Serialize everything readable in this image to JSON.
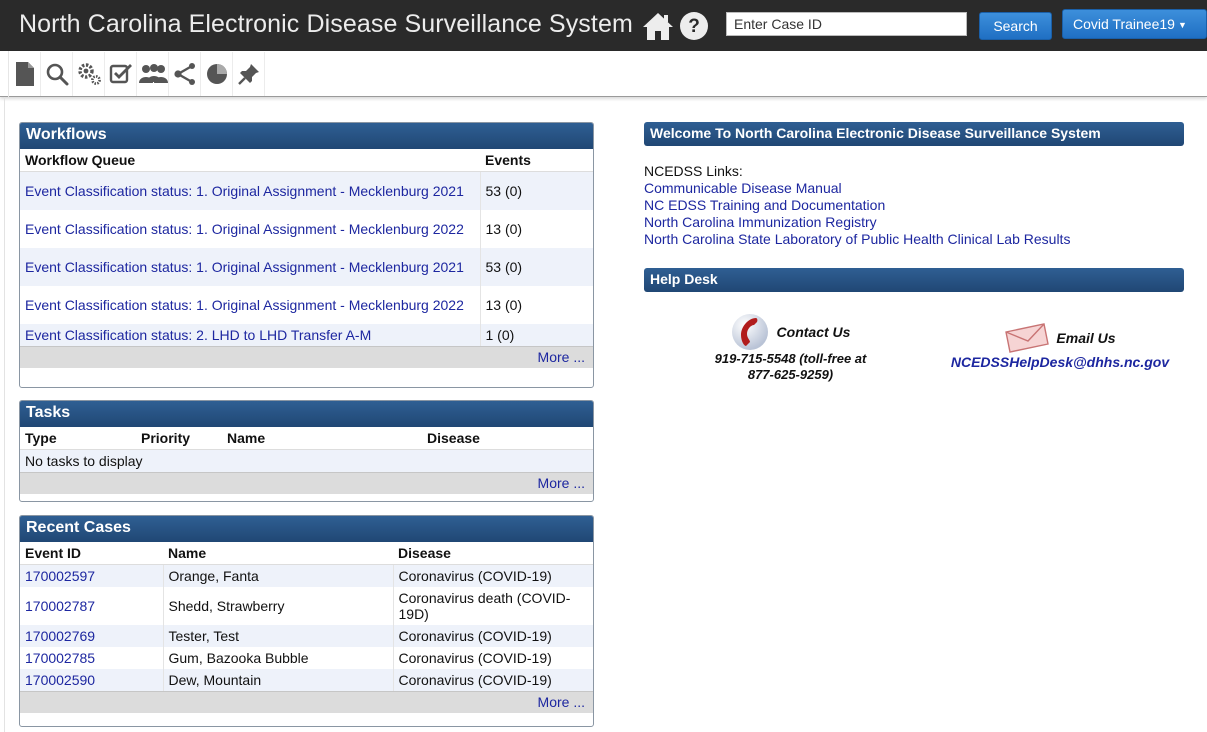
{
  "header": {
    "title": "North Carolina Electronic Disease Surveillance System",
    "case_placeholder": "Enter Case ID",
    "search_label": "Search",
    "user_label": "Covid Trainee19",
    "icons": [
      "home-icon",
      "help-icon"
    ]
  },
  "toolbar": {
    "icons": [
      "new-document-icon",
      "search-icon",
      "settings-gears-icon",
      "checklist-icon",
      "people-icon",
      "share-icon",
      "pie-chart-icon",
      "pin-icon"
    ]
  },
  "workflows": {
    "title": "Workflows",
    "col_queue": "Workflow Queue",
    "col_events": "Events",
    "rows": [
      {
        "queue": "Event Classification status: 1. Original Assignment - Mecklenburg 2021",
        "events": "53 (0)"
      },
      {
        "queue": "Event Classification status: 1. Original Assignment - Mecklenburg 2022",
        "events": "13 (0)"
      },
      {
        "queue": "Event Classification status: 1. Original Assignment - Mecklenburg 2021",
        "events": "53 (0)"
      },
      {
        "queue": "Event Classification status: 1. Original Assignment - Mecklenburg 2022",
        "events": "13 (0)"
      },
      {
        "queue": "Event Classification status: 2. LHD to LHD Transfer A-M",
        "events": "1 (0)"
      }
    ],
    "more": "More ..."
  },
  "tasks": {
    "title": "Tasks",
    "col_type": "Type",
    "col_priority": "Priority",
    "col_name": "Name",
    "col_disease": "Disease",
    "empty": "No tasks to display",
    "more": "More ..."
  },
  "recent_cases": {
    "title": "Recent Cases",
    "col_event": "Event ID",
    "col_name": "Name",
    "col_disease": "Disease",
    "rows": [
      {
        "event_id": "170002597",
        "name": "Orange, Fanta",
        "disease": "Coronavirus (COVID-19)"
      },
      {
        "event_id": "170002787",
        "name": "Shedd, Strawberry",
        "disease": "Coronavirus death (COVID-19D)"
      },
      {
        "event_id": "170002769",
        "name": "Tester, Test",
        "disease": "Coronavirus (COVID-19)"
      },
      {
        "event_id": "170002785",
        "name": "Gum, Bazooka Bubble",
        "disease": "Coronavirus (COVID-19)"
      },
      {
        "event_id": "170002590",
        "name": "Dew, Mountain",
        "disease": "Coronavirus (COVID-19)"
      }
    ],
    "more": "More ..."
  },
  "welcome": {
    "title": "Welcome To North Carolina Electronic Disease Surveillance System",
    "links_label": "NCEDSS Links:",
    "links": [
      "Communicable Disease Manual",
      "NC EDSS Training and Documentation",
      "North Carolina Immunization Registry",
      "North Carolina State Laboratory of Public Health Clinical Lab Results"
    ]
  },
  "helpdesk": {
    "title": "Help Desk",
    "contact_label": "Contact Us",
    "phone_line1": "919-715-5548 (toll-free at",
    "phone_line2": "877-625-9259)",
    "email_label": "Email Us",
    "email": "NCEDSSHelpDesk@dhhs.nc.gov",
    "icons": [
      "phone-icon",
      "envelope-icon"
    ]
  },
  "colors": {
    "topbar": "#2a2a2a",
    "panel_header": "#2a5689",
    "button_blue": "#2a7fd4",
    "link": "#1d27a0",
    "row_alt": "#eef2fa"
  }
}
